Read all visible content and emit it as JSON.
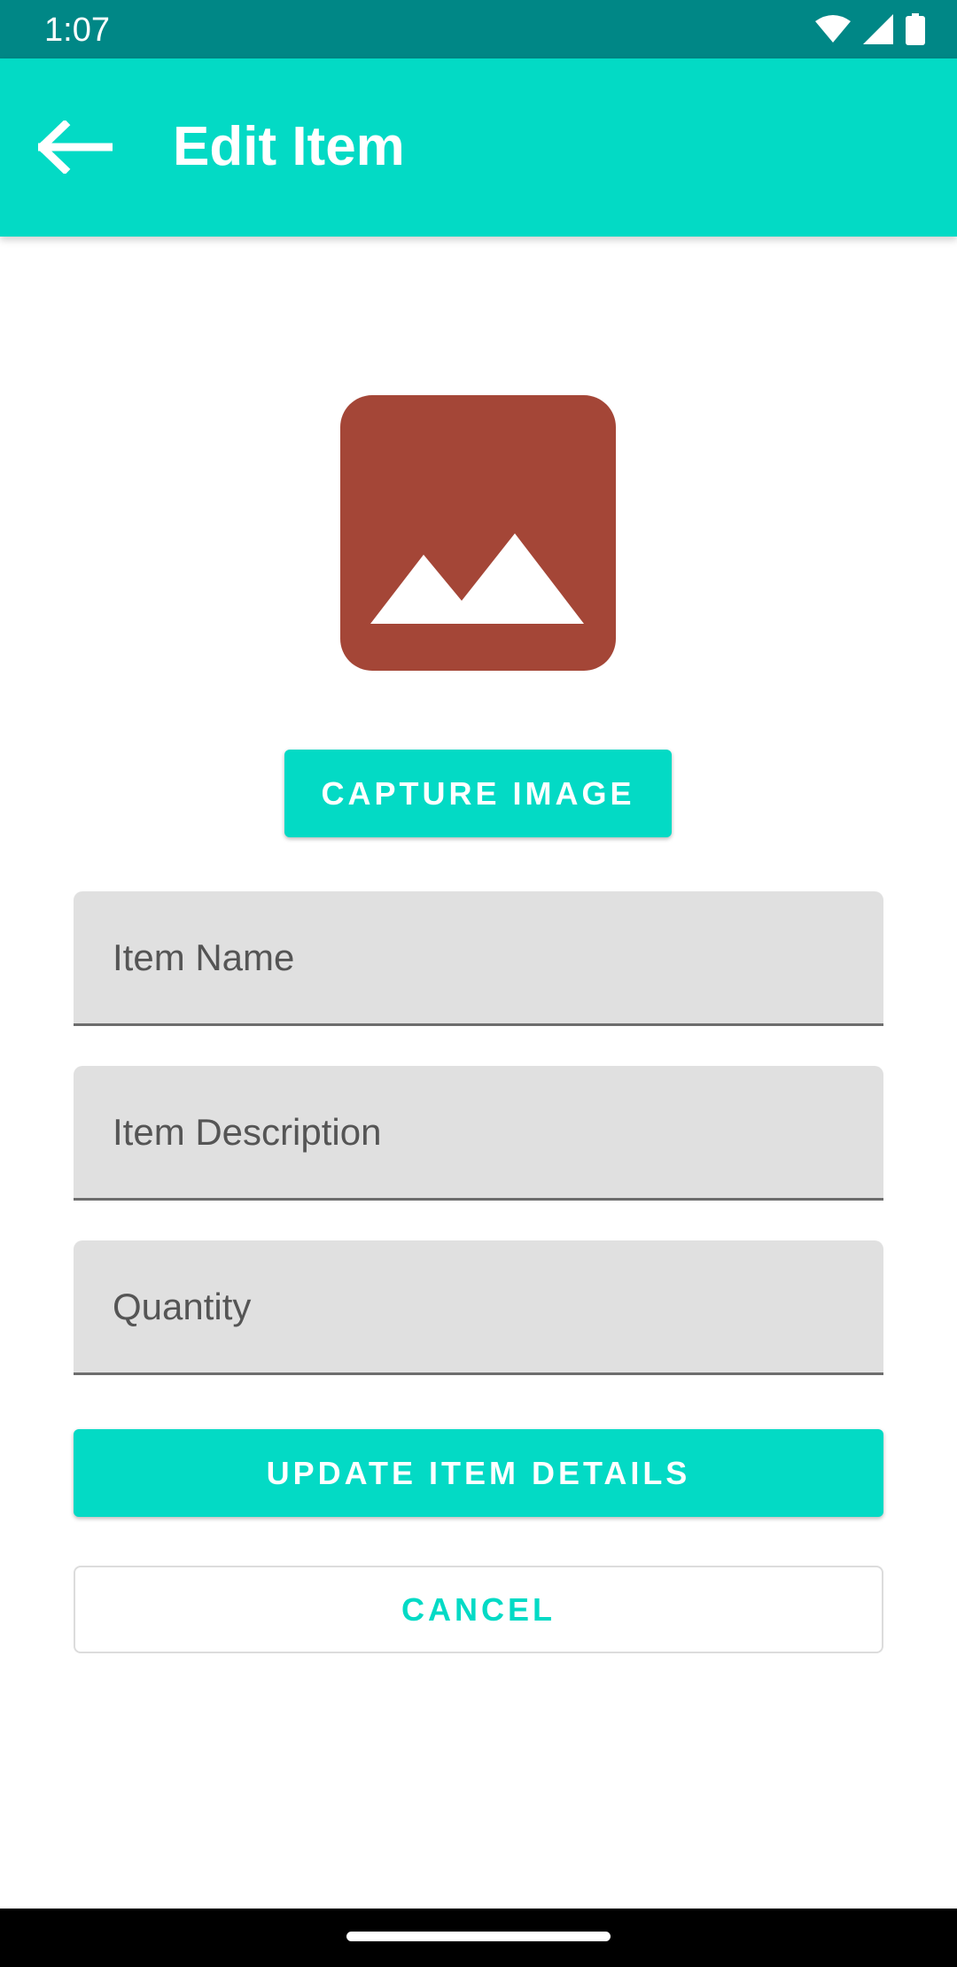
{
  "status_bar": {
    "time": "1:07",
    "icons": [
      "wifi-icon",
      "signal-icon",
      "battery-icon"
    ]
  },
  "app_bar": {
    "title": "Edit Item",
    "back_icon": "arrow-left-icon"
  },
  "image_placeholder": {
    "icon": "image-icon"
  },
  "buttons": {
    "capture": "CAPTURE IMAGE",
    "update": "UPDATE ITEM DETAILS",
    "cancel": "CANCEL"
  },
  "fields": {
    "name": {
      "placeholder": "Item Name",
      "value": ""
    },
    "description": {
      "placeholder": "Item Description",
      "value": ""
    },
    "quantity": {
      "placeholder": "Quantity",
      "value": ""
    }
  },
  "colors": {
    "status_bar": "#008786",
    "accent": "#03dac5",
    "image_bg": "#a44637",
    "field_bg": "#e0e0e0"
  }
}
